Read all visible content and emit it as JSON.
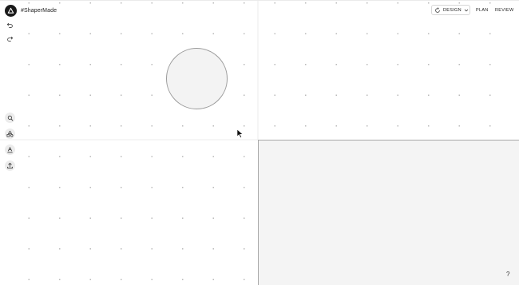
{
  "app": {
    "title": "#ShaperMade"
  },
  "header": {
    "mode_label": "DESIGN",
    "nav": [
      {
        "label": "PLAN"
      },
      {
        "label": "REVIEW"
      }
    ]
  },
  "toolbar": {
    "tools": [
      {
        "name": "undo-icon"
      },
      {
        "name": "redo-icon"
      },
      {
        "name": "search-icon"
      },
      {
        "name": "shapes-icon"
      },
      {
        "name": "text-icon"
      },
      {
        "name": "upload-icon"
      }
    ]
  },
  "help": {
    "label": "?"
  },
  "colors": {
    "logo": "#1a1a1a",
    "workspace": "#f4f4f4",
    "canvas": "#ffffff"
  }
}
